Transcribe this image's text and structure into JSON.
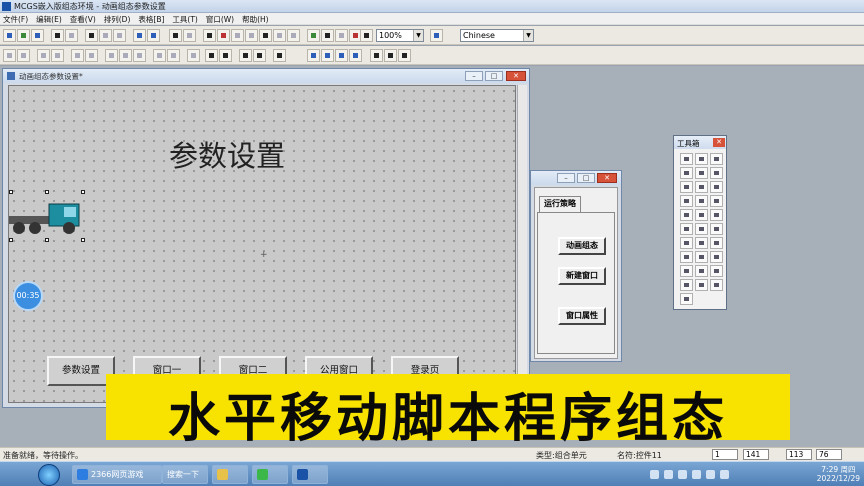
{
  "app": {
    "title": "MCGS嵌入版组态环境 - 动画组态参数设置"
  },
  "menu": [
    "文件(F)",
    "编辑(E)",
    "查看(V)",
    "排列(D)",
    "表格[B]",
    "工具(T)",
    "窗口(W)",
    "帮助(H)"
  ],
  "toolbar": {
    "zoom_value": "100%",
    "language_value": "Chinese"
  },
  "editor_window": {
    "title": "动画组态参数设置*",
    "canvas_title": "参数设置",
    "buttons": [
      "参数设置",
      "窗口一",
      "窗口二",
      "公用窗口",
      "登录页"
    ]
  },
  "timer": {
    "text": "00:35"
  },
  "strategy_window": {
    "tab": "运行策略",
    "buttons": [
      "动画组态",
      "新建窗口",
      "窗口属性"
    ]
  },
  "toolbox": {
    "title": "工具箱"
  },
  "banner": {
    "text": "水平移动脚本程序组态"
  },
  "status": {
    "left": "准备就绪，等待操作。",
    "type": "类型:组合单元",
    "name": "名符:控件11",
    "boxes": [
      "1",
      "141",
      "113",
      "76"
    ]
  },
  "taskbar": {
    "tasks": [
      "2366网页游戏",
      "搜索一下",
      "",
      "",
      "MCGS"
    ],
    "time": "7:29 周四",
    "date": "2022/12/29"
  }
}
